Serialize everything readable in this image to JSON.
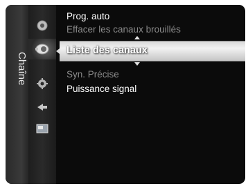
{
  "sidebar": {
    "label": "Chaîne"
  },
  "icons": [
    {
      "name": "picture-icon"
    },
    {
      "name": "channel-icon"
    },
    {
      "name": "setup-icon"
    },
    {
      "name": "input-icon"
    },
    {
      "name": "application-icon"
    }
  ],
  "menu": {
    "items_above": [
      "Prog. auto",
      "Effacer les canaux brouillés"
    ],
    "selected": "Liste des canaux",
    "items_below": [
      "Syn. Précise",
      "Puissance signal"
    ]
  },
  "colors": {
    "selected_bg": "#e6e6e6",
    "dim_text": "#8b8b8b",
    "text": "#ffffff"
  }
}
